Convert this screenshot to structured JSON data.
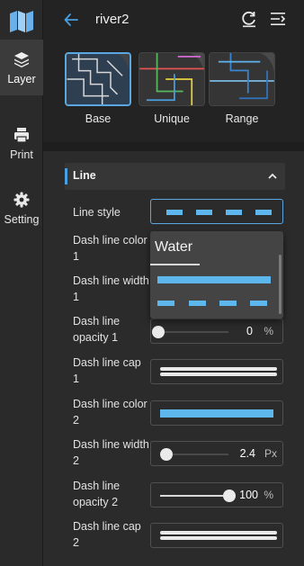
{
  "app": {
    "title": "river2",
    "accent": "#4a9fe0",
    "line_color": "#5db6ec"
  },
  "rail": {
    "logo_icon": "map-logo-icon",
    "items": [
      {
        "label": "Layer",
        "icon": "layers-icon",
        "active": true
      },
      {
        "label": "Print",
        "icon": "printer-icon",
        "active": false
      },
      {
        "label": "Setting",
        "icon": "gear-icon",
        "active": false
      }
    ]
  },
  "header": {
    "back_icon": "arrow-left-icon",
    "icons": [
      "reset-icon",
      "collapse-panel-icon"
    ]
  },
  "styles": [
    {
      "label": "Base",
      "selected": true
    },
    {
      "label": "Unique",
      "selected": false
    },
    {
      "label": "Range",
      "selected": false
    }
  ],
  "section": {
    "title": "Line",
    "icon": "chevron-up-icon"
  },
  "props": {
    "line_style": "Line style",
    "dash_color_1": "Dash line color 1",
    "dash_width_1": "Dash line width 1",
    "dash_opacity_1": "Dash line opacity 1",
    "dash_cap_1": "Dash line cap 1",
    "dash_color_2": "Dash line color 2",
    "dash_width_2": "Dash line width 2",
    "dash_opacity_2": "Dash line opacity 2",
    "dash_cap_2": "Dash line cap 2"
  },
  "values": {
    "opacity_1": "0",
    "opacity_1_unit": "%",
    "opacity_1_fraction": 0,
    "width_2": "2.4",
    "width_2_unit": "Px",
    "width_2_fraction": 0.05,
    "opacity_2": "100",
    "opacity_2_unit": "%",
    "opacity_2_fraction": 1
  },
  "dropdown": {
    "tab": "Water",
    "options": [
      "solid-line",
      "dashed-line"
    ]
  }
}
